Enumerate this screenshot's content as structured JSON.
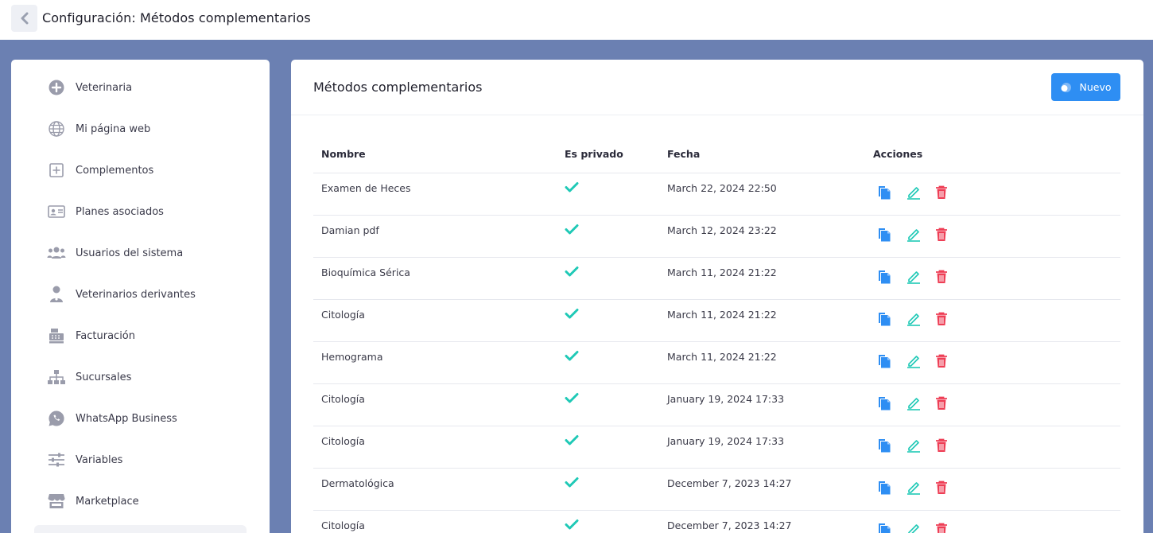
{
  "header": {
    "title": "Configuración: Métodos complementarios"
  },
  "sidebar": {
    "items": [
      {
        "label": "Veterinaria",
        "icon": "plus-circle-icon"
      },
      {
        "label": "Mi página web",
        "icon": "globe-icon"
      },
      {
        "label": "Complementos",
        "icon": "plus-square-icon"
      },
      {
        "label": "Planes asociados",
        "icon": "id-card-icon"
      },
      {
        "label": "Usuarios del sistema",
        "icon": "users-icon"
      },
      {
        "label": "Veterinarios derivantes",
        "icon": "doctor-icon"
      },
      {
        "label": "Facturación",
        "icon": "cash-register-icon"
      },
      {
        "label": "Sucursales",
        "icon": "sitemap-icon"
      },
      {
        "label": "WhatsApp Business",
        "icon": "whatsapp-icon"
      },
      {
        "label": "Variables",
        "icon": "sliders-icon"
      },
      {
        "label": "Marketplace",
        "icon": "store-icon"
      }
    ]
  },
  "main": {
    "title": "Métodos complementarios",
    "new_button": "Nuevo",
    "columns": [
      "Nombre",
      "Es privado",
      "Fecha",
      "Acciones"
    ],
    "rows": [
      {
        "nombre": "Examen de Heces",
        "privado": true,
        "fecha": "March 22, 2024 22:50"
      },
      {
        "nombre": "Damian pdf",
        "privado": true,
        "fecha": "March 12, 2024 23:22"
      },
      {
        "nombre": "Bioquímica Sérica",
        "privado": true,
        "fecha": "March 11, 2024 21:22"
      },
      {
        "nombre": "Citología",
        "privado": true,
        "fecha": "March 11, 2024 21:22"
      },
      {
        "nombre": "Hemograma",
        "privado": true,
        "fecha": "March 11, 2024 21:22"
      },
      {
        "nombre": "Citología",
        "privado": true,
        "fecha": "January 19, 2024 17:33"
      },
      {
        "nombre": "Citología",
        "privado": true,
        "fecha": "January 19, 2024 17:33"
      },
      {
        "nombre": "Dermatológica",
        "privado": true,
        "fecha": "December 7, 2023 14:27"
      },
      {
        "nombre": "Citología",
        "privado": true,
        "fecha": "December 7, 2023 14:27"
      }
    ]
  },
  "colors": {
    "background": "#6b80b2",
    "primary": "#2e8ef3",
    "check": "#1fc9b6",
    "edit": "#1fc9b6",
    "delete": "#ee3e55",
    "copy": "#2e8ef3"
  }
}
